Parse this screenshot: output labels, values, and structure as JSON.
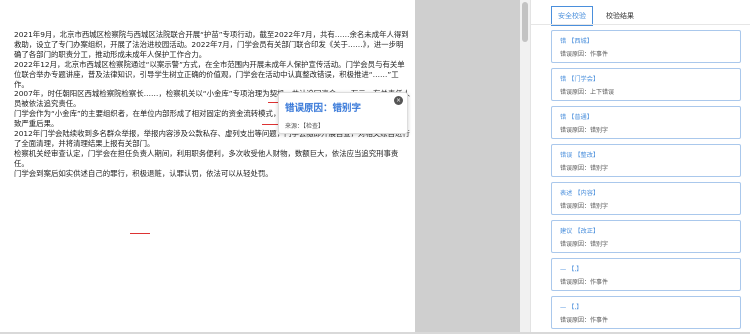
{
  "document": {
    "paragraphs": [
      "2021年9月，北京市西城区检察院与西城区法院联合开展“护苗”专项行动，截至2022年7月，共有……余名未成年人得到救助，设立了专门办案组织，开展了法治进校园活动。2022年7月，门学会员有关部门联合印发《关于……》，进一步明确了各部门的职责分工，推动形成未成年人保护工作合力。",
      "2022年12月，北京市西城区检察院通过“以案示警”方式，在全市范围内开展未成年人保护宣传活动。门学会员与有关单位联合举办专题讲座，普及法律知识，引导学生树立正确的价值观，门学会在活动中认真整改错误，积极推进“……”工作。",
      "2007年，时任朝阳区西城检察院检察长……，检察机关以“小金库”专项治理为契机，共计追回资金……万元，有关责任人员被依法追究责任。",
      "门学会作为“小金库”的主要组织者，在单位内部形成了相对固定的资金流转模式，资金长期游离于财务监管之外，最终导致严重后果。",
      "2012年门学会陆续收到多名群众举报，举报内容涉及公款私存、虚列支出等问题，门学会随即开展自查，对相关账目进行了全面清理，并将清理结果上报有关部门。",
      "检察机关经审查认定，门学会在担任负责人期间，利用职务便利，多次收受他人财物，数额巨大，依法应当追究刑事责任。",
      "门学会到案后如实供述自己的罪行，积极退赃，认罪认罚，依法可以从轻处罚。"
    ]
  },
  "popup": {
    "message": "错误原因：错别字",
    "source": "来源：【检查】"
  },
  "panel": {
    "tabs": [
      "安全校验",
      "校验结果"
    ],
    "cards": [
      {
        "title": "错 【西城】",
        "reason": "错误原因：作事件"
      },
      {
        "title": "错 【门学会】",
        "reason": "错误原因：上下错误"
      },
      {
        "title": "错 【普通】",
        "reason": "错误原因：错别字"
      },
      {
        "title": "错误 【整改】",
        "reason": "错误原因：错别字"
      },
      {
        "title": "表述 【内容】",
        "reason": "错误原因：错别字"
      },
      {
        "title": "建议 【改正】",
        "reason": "错误原因：错别字"
      },
      {
        "title": "— 【,】",
        "reason": "错误原因：作事件"
      },
      {
        "title": "— 【,】",
        "reason": "错误原因：作事件"
      }
    ]
  }
}
